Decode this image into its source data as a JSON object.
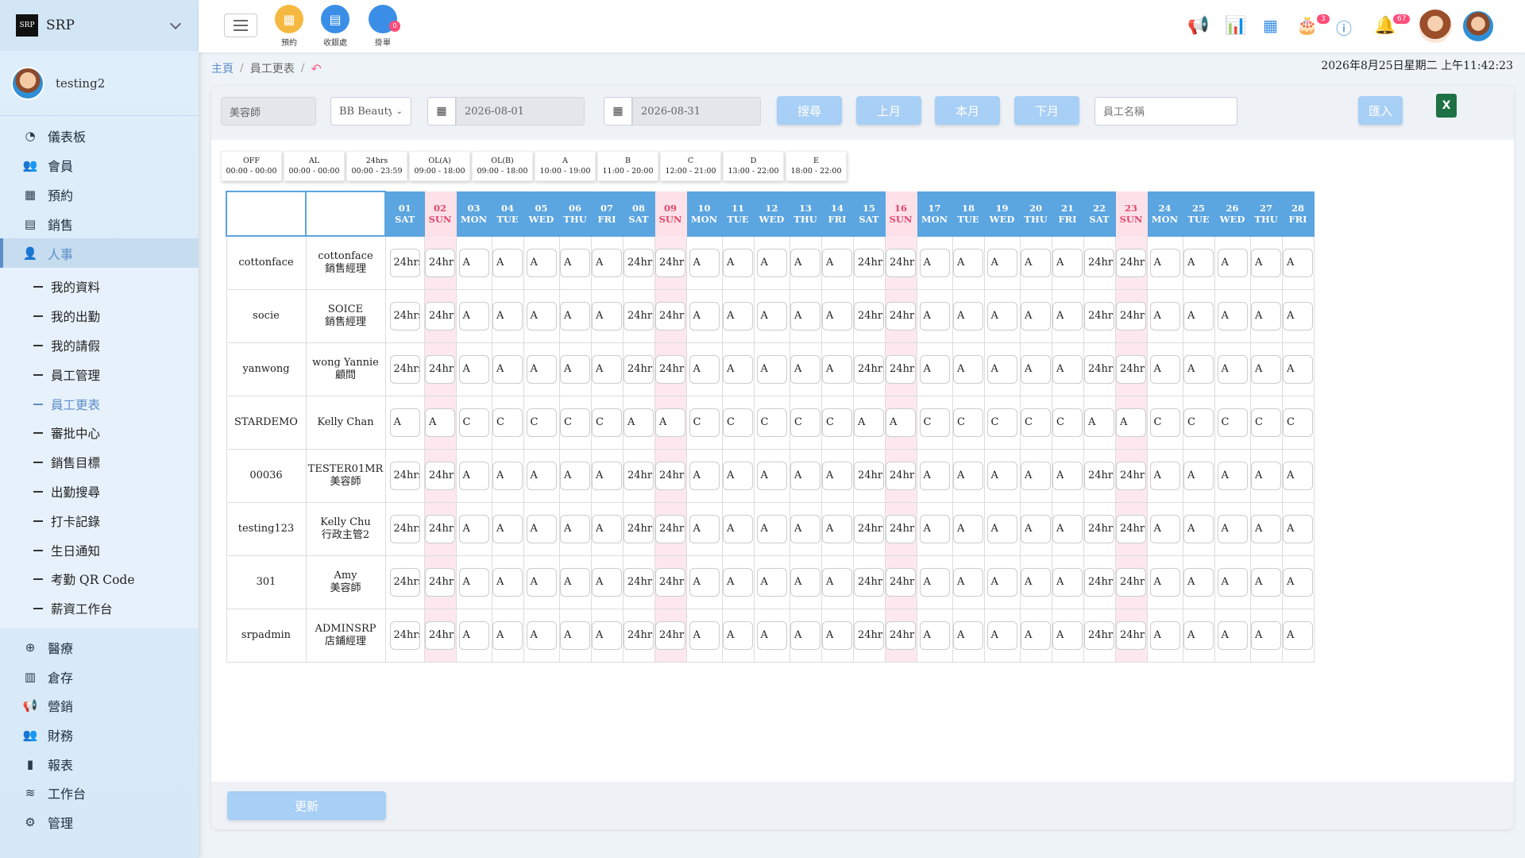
{
  "brand": {
    "name": "SRP",
    "logo_text": "SRP"
  },
  "user": {
    "name": "testing2"
  },
  "nav_top": [
    {
      "label": "儀表板",
      "icon": "◔",
      "name": "dashboard"
    },
    {
      "label": "會員",
      "icon": "👥",
      "name": "members"
    },
    {
      "label": "預約",
      "icon": "▦",
      "name": "booking"
    },
    {
      "label": "銷售",
      "icon": "▤",
      "name": "sales"
    },
    {
      "label": "人事",
      "icon": "👤",
      "name": "hr",
      "active": true
    }
  ],
  "nav_sub": [
    {
      "label": "我的資料"
    },
    {
      "label": "我的出勤"
    },
    {
      "label": "我的請假"
    },
    {
      "label": "員工管理"
    },
    {
      "label": "員工更表",
      "active": true
    },
    {
      "label": "審批中心"
    },
    {
      "label": "銷售目標"
    },
    {
      "label": "出勤搜尋"
    },
    {
      "label": "打卡記錄"
    },
    {
      "label": "生日通知"
    },
    {
      "label": "考勤 QR Code"
    },
    {
      "label": "薪資工作台"
    }
  ],
  "nav_bottom": [
    {
      "label": "醫療",
      "icon": "⊕",
      "name": "medical"
    },
    {
      "label": "倉存",
      "icon": "▥",
      "name": "inventory"
    },
    {
      "label": "營銷",
      "icon": "📢",
      "name": "marketing"
    },
    {
      "label": "財務",
      "icon": "👥",
      "name": "finance"
    },
    {
      "label": "報表",
      "icon": "▮",
      "name": "reports"
    },
    {
      "label": "工作台",
      "icon": "≋",
      "name": "workbench"
    },
    {
      "label": "管理",
      "icon": "⚙",
      "name": "admin"
    }
  ],
  "topbar": {
    "quick": [
      {
        "label": "預約",
        "color": "#f5b942",
        "icon": "▦",
        "badge": ""
      },
      {
        "label": "收銀處",
        "color": "#3a8ee6",
        "icon": "▤",
        "badge": ""
      },
      {
        "label": "掛單",
        "color": "#3a8ee6",
        "icon": "",
        "badge": "0"
      }
    ],
    "badges": {
      "cake": "3",
      "bell": "67"
    }
  },
  "breadcrumb": {
    "home": "主頁",
    "current": "員工更表"
  },
  "datetime": "2026年8月25日星期二 上午11:42:23",
  "filters": {
    "role": "美容師",
    "shop": "BB Beauty",
    "date_from": "2026-08-01",
    "date_to": "2026-08-31",
    "search_btn": "搜尋",
    "prev_btn": "上月",
    "this_btn": "本月",
    "next_btn": "下月",
    "name_placeholder": "員工名稱",
    "import_btn": "匯入"
  },
  "legend": [
    {
      "code": "OFF",
      "time": "00:00 - 00:00"
    },
    {
      "code": "AL",
      "time": "00:00 - 00:00"
    },
    {
      "code": "24hrs",
      "time": "00:00 - 23:59"
    },
    {
      "code": "OL(A)",
      "time": "09:00 - 18:00"
    },
    {
      "code": "OL(B)",
      "time": "09:00 - 18:00"
    },
    {
      "code": "A",
      "time": "10:00 - 19:00"
    },
    {
      "code": "B",
      "time": "11:00 - 20:00"
    },
    {
      "code": "C",
      "time": "12:00 - 21:00"
    },
    {
      "code": "D",
      "time": "13:00 - 22:00"
    },
    {
      "code": "E",
      "time": "18:00 - 22:00"
    }
  ],
  "days": [
    {
      "d": "01",
      "w": "SAT"
    },
    {
      "d": "02",
      "w": "SUN"
    },
    {
      "d": "03",
      "w": "MON"
    },
    {
      "d": "04",
      "w": "TUE"
    },
    {
      "d": "05",
      "w": "WED"
    },
    {
      "d": "06",
      "w": "THU"
    },
    {
      "d": "07",
      "w": "FRI"
    },
    {
      "d": "08",
      "w": "SAT"
    },
    {
      "d": "09",
      "w": "SUN"
    },
    {
      "d": "10",
      "w": "MON"
    },
    {
      "d": "11",
      "w": "TUE"
    },
    {
      "d": "12",
      "w": "WED"
    },
    {
      "d": "13",
      "w": "THU"
    },
    {
      "d": "14",
      "w": "FRI"
    },
    {
      "d": "15",
      "w": "SAT"
    },
    {
      "d": "16",
      "w": "SUN"
    },
    {
      "d": "17",
      "w": "MON"
    },
    {
      "d": "18",
      "w": "TUE"
    },
    {
      "d": "19",
      "w": "WED"
    },
    {
      "d": "20",
      "w": "THU"
    },
    {
      "d": "21",
      "w": "FRI"
    },
    {
      "d": "22",
      "w": "SAT"
    },
    {
      "d": "23",
      "w": "SUN"
    },
    {
      "d": "24",
      "w": "MON"
    },
    {
      "d": "25",
      "w": "TUE"
    },
    {
      "d": "26",
      "w": "WED"
    },
    {
      "d": "27",
      "w": "THU"
    },
    {
      "d": "28",
      "w": "FRI"
    }
  ],
  "employees": [
    {
      "code": "cottonface",
      "name": "cottonface",
      "title": "銷售經理",
      "pattern": "standard"
    },
    {
      "code": "socie",
      "name": "SOICE",
      "title": "銷售經理",
      "pattern": "standard"
    },
    {
      "code": "yanwong",
      "name": "wong Yannie",
      "title": "顧問",
      "pattern": "standard"
    },
    {
      "code": "STARDEMO",
      "name": "Kelly Chan",
      "title": "",
      "pattern": "ac"
    },
    {
      "code": "00036",
      "name": "TESTER01MR",
      "title": "美容師",
      "pattern": "standard"
    },
    {
      "code": "testing123",
      "name": "Kelly Chu",
      "title": "行政主管2",
      "pattern": "standard"
    },
    {
      "code": "301",
      "name": "Amy",
      "title": "美容師",
      "pattern": "standard"
    },
    {
      "code": "srpadmin",
      "name": "ADMINSRP",
      "title": "店鋪經理",
      "pattern": "standard"
    }
  ],
  "footer": {
    "update_btn": "更新"
  }
}
